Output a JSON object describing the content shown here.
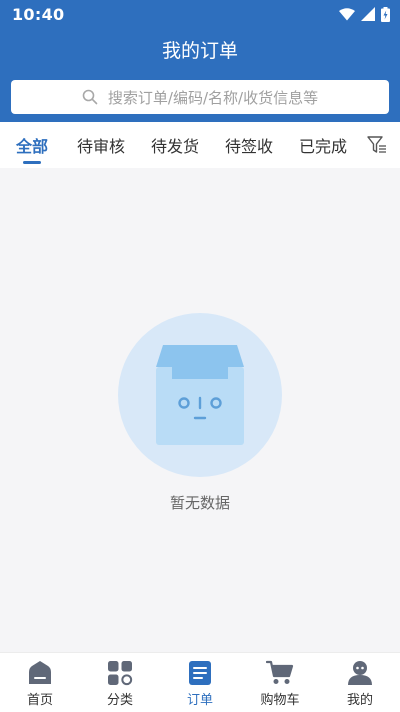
{
  "status_bar": {
    "time": "10:40"
  },
  "header": {
    "title": "我的订单"
  },
  "search": {
    "placeholder": "搜索订单/编码/名称/收货信息等"
  },
  "tabs": [
    {
      "label": "全部",
      "active": true
    },
    {
      "label": "待审核",
      "active": false
    },
    {
      "label": "待发货",
      "active": false
    },
    {
      "label": "待签收",
      "active": false
    },
    {
      "label": "已完成",
      "active": false
    }
  ],
  "empty_state": {
    "text": "暂无数据"
  },
  "bottom_nav": [
    {
      "label": "首页",
      "icon": "home-icon",
      "active": false
    },
    {
      "label": "分类",
      "icon": "category-icon",
      "active": false
    },
    {
      "label": "订单",
      "icon": "order-icon",
      "active": true
    },
    {
      "label": "购物车",
      "icon": "cart-icon",
      "active": false
    },
    {
      "label": "我的",
      "icon": "profile-icon",
      "active": false
    }
  ],
  "colors": {
    "brand": "#2e6fbe",
    "inactive": "#606878",
    "background": "#f5f5f7"
  }
}
